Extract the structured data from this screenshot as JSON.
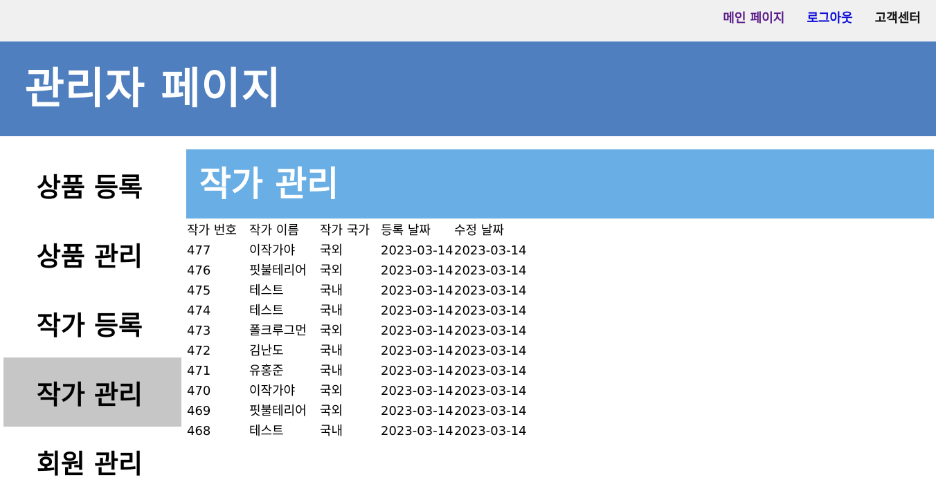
{
  "top_nav": {
    "main_page": "메인 페이지",
    "logout": "로그아웃",
    "customer_center": "고객센터"
  },
  "banner": {
    "title": "관리자 페이지"
  },
  "sidebar": {
    "items": [
      {
        "label": "상품 등록",
        "active": false
      },
      {
        "label": "상품 관리",
        "active": false
      },
      {
        "label": "작가 등록",
        "active": false
      },
      {
        "label": "작가 관리",
        "active": true
      },
      {
        "label": "회원 관리",
        "active": false
      }
    ]
  },
  "main": {
    "title": "작가 관리",
    "table": {
      "columns": [
        "작가 번호",
        "작가 이름",
        "작가 국가",
        "등록 날짜",
        "수정 날짜"
      ],
      "rows": [
        [
          "477",
          "이작가야",
          "국외",
          "2023-03-14",
          "2023-03-14"
        ],
        [
          "476",
          "핏불테리어",
          "국외",
          "2023-03-14",
          "2023-03-14"
        ],
        [
          "475",
          "테스트",
          "국내",
          "2023-03-14",
          "2023-03-14"
        ],
        [
          "474",
          "테스트",
          "국내",
          "2023-03-14",
          "2023-03-14"
        ],
        [
          "473",
          "폴크루그먼",
          "국외",
          "2023-03-14",
          "2023-03-14"
        ],
        [
          "472",
          "김난도",
          "국내",
          "2023-03-14",
          "2023-03-14"
        ],
        [
          "471",
          "유홍준",
          "국내",
          "2023-03-14",
          "2023-03-14"
        ],
        [
          "470",
          "이작가야",
          "국외",
          "2023-03-14",
          "2023-03-14"
        ],
        [
          "469",
          "핏불테리어",
          "국외",
          "2023-03-14",
          "2023-03-14"
        ],
        [
          "468",
          "테스트",
          "국내",
          "2023-03-14",
          "2023-03-14"
        ]
      ]
    }
  },
  "colors": {
    "topbar_bg": "#f0f0f0",
    "banner_bg": "#4f7fbe",
    "content_header_bg": "#69aee4",
    "sidebar_active_bg": "#c6c6c6",
    "link_visited": "#5a1c8a",
    "link": "#0a0ad8"
  }
}
